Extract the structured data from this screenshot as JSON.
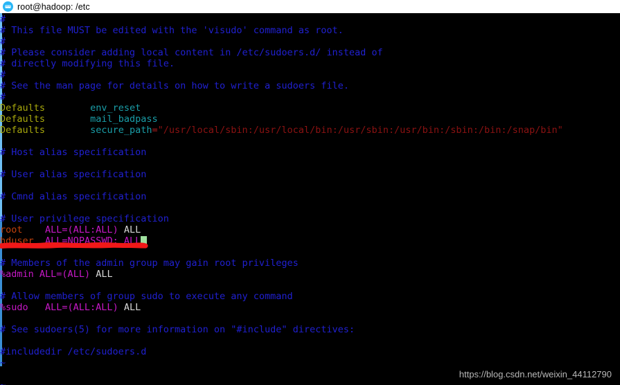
{
  "titlebar": {
    "icon": "terminal-app-icon",
    "title": "root@hadoop: /etc"
  },
  "terminal": {
    "lines": [
      {
        "segments": [
          {
            "text": "#",
            "cls": "c-comment"
          }
        ]
      },
      {
        "segments": [
          {
            "text": "# This file MUST be edited with the 'visudo' command as root.",
            "cls": "c-comment"
          }
        ]
      },
      {
        "segments": [
          {
            "text": "#",
            "cls": "c-comment"
          }
        ]
      },
      {
        "segments": [
          {
            "text": "# Please consider adding local content in /etc/sudoers.d/ instead of",
            "cls": "c-comment"
          }
        ]
      },
      {
        "segments": [
          {
            "text": "# directly modifying this file.",
            "cls": "c-comment"
          }
        ]
      },
      {
        "segments": [
          {
            "text": "#",
            "cls": "c-comment"
          }
        ]
      },
      {
        "segments": [
          {
            "text": "# See the man page for details on how to write a sudoers file.",
            "cls": "c-comment"
          }
        ]
      },
      {
        "segments": [
          {
            "text": "#",
            "cls": "c-comment"
          }
        ]
      },
      {
        "segments": [
          {
            "text": "Defaults",
            "cls": "c-kw"
          },
          {
            "text": "        ",
            "cls": "c-plain"
          },
          {
            "text": "env_reset",
            "cls": "c-opt"
          }
        ]
      },
      {
        "segments": [
          {
            "text": "Defaults",
            "cls": "c-kw"
          },
          {
            "text": "        ",
            "cls": "c-plain"
          },
          {
            "text": "mail_badpass",
            "cls": "c-opt"
          }
        ]
      },
      {
        "segments": [
          {
            "text": "Defaults",
            "cls": "c-kw"
          },
          {
            "text": "        ",
            "cls": "c-plain"
          },
          {
            "text": "secure_path",
            "cls": "c-opt"
          },
          {
            "text": "=",
            "cls": "c-op"
          },
          {
            "text": "\"/usr/local/sbin:/usr/local/bin:/usr/sbin:/usr/bin:/sbin:/bin:/snap/bin\"",
            "cls": "c-str"
          }
        ]
      },
      {
        "segments": []
      },
      {
        "segments": [
          {
            "text": "# Host alias specification",
            "cls": "c-comment"
          }
        ]
      },
      {
        "segments": []
      },
      {
        "segments": [
          {
            "text": "# User alias specification",
            "cls": "c-comment"
          }
        ]
      },
      {
        "segments": []
      },
      {
        "segments": [
          {
            "text": "# Cmnd alias specification",
            "cls": "c-comment"
          }
        ]
      },
      {
        "segments": []
      },
      {
        "segments": [
          {
            "text": "# User privilege specification",
            "cls": "c-comment"
          }
        ]
      },
      {
        "segments": [
          {
            "text": "root",
            "cls": "c-user"
          },
          {
            "text": "    ",
            "cls": "c-plain"
          },
          {
            "text": "ALL=(ALL:ALL)",
            "cls": "c-spec"
          },
          {
            "text": " ALL",
            "cls": "c-plain"
          }
        ]
      },
      {
        "segments": [
          {
            "text": "hduser",
            "cls": "c-user"
          },
          {
            "text": "  ",
            "cls": "c-plain"
          },
          {
            "text": "ALL=NOPASSWD:",
            "cls": "c-spec"
          },
          {
            "text": " ALL",
            "cls": "c-spec"
          }
        ],
        "cursor_after": true
      },
      {
        "segments": []
      },
      {
        "segments": [
          {
            "text": "# Members of the admin group may gain root privileges",
            "cls": "c-comment"
          }
        ]
      },
      {
        "segments": [
          {
            "text": "%admin",
            "cls": "c-spec"
          },
          {
            "text": " ",
            "cls": "c-plain"
          },
          {
            "text": "ALL=(ALL)",
            "cls": "c-spec"
          },
          {
            "text": " ALL",
            "cls": "c-plain"
          }
        ]
      },
      {
        "segments": []
      },
      {
        "segments": [
          {
            "text": "# Allow members of group sudo to execute any command",
            "cls": "c-comment"
          }
        ]
      },
      {
        "segments": [
          {
            "text": "%sudo",
            "cls": "c-spec"
          },
          {
            "text": "   ",
            "cls": "c-plain"
          },
          {
            "text": "ALL=(ALL:ALL)",
            "cls": "c-spec"
          },
          {
            "text": " ALL",
            "cls": "c-plain"
          }
        ]
      },
      {
        "segments": []
      },
      {
        "segments": [
          {
            "text": "# See sudoers(5) for more information on \"#include\" directives:",
            "cls": "c-comment"
          }
        ]
      },
      {
        "segments": []
      },
      {
        "segments": [
          {
            "text": "#includedir /etc/sudoers.d",
            "cls": "c-comment"
          }
        ]
      },
      {
        "segments": [
          {
            "text": "~",
            "cls": "c-tilde"
          }
        ]
      },
      {
        "segments": []
      },
      {
        "segments": [
          {
            "text": "~",
            "cls": "c-tilde"
          }
        ]
      }
    ]
  },
  "annotation": {
    "type": "hand-drawn-underline",
    "color": "#f01818",
    "target_line": "hduser  ALL=NOPASSWD: ALL"
  },
  "watermark": {
    "text": "https://blog.csdn.net/weixin_44112790"
  },
  "colors": {
    "background": "#000000",
    "titlebar_background": "#ffffff",
    "comment": "#2020d0",
    "keyword": "#a8a80c",
    "option": "#1a9ea8",
    "string": "#8c1212",
    "username": "#c2410c",
    "spec": "#c718c7",
    "cursor": "#9fe09f",
    "annotation_red": "#f01818",
    "scrollbar": "#6fc0f5"
  }
}
